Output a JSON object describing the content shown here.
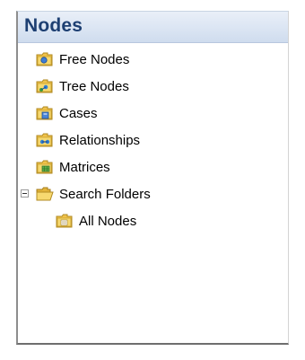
{
  "panel": {
    "title": "Nodes"
  },
  "tree": {
    "items": [
      {
        "label": "Free Nodes",
        "icon": "free-nodes-folder-icon"
      },
      {
        "label": "Tree Nodes",
        "icon": "tree-nodes-folder-icon"
      },
      {
        "label": "Cases",
        "icon": "cases-folder-icon"
      },
      {
        "label": "Relationships",
        "icon": "relationships-folder-icon"
      },
      {
        "label": "Matrices",
        "icon": "matrices-folder-icon"
      },
      {
        "label": "Search Folders",
        "icon": "search-folder-open-icon",
        "expanded": true
      },
      {
        "label": "All Nodes",
        "icon": "all-nodes-folder-icon"
      }
    ]
  },
  "colors": {
    "header_text": "#1d3f72",
    "header_bg": "#dbe5f3",
    "folder_yellow": "#f3c94b"
  }
}
